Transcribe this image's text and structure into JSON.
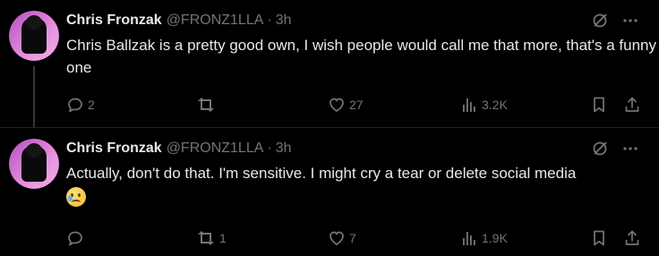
{
  "tweets": [
    {
      "name": "Chris Fronzak",
      "handle": "@FRONZ1LLA",
      "separator": "·",
      "time": "3h",
      "text": "Chris Ballzak is a pretty good own, I wish people would call me that more, that's a funny one",
      "replies": "2",
      "retweets": "",
      "likes": "27",
      "views": "3.2K"
    },
    {
      "name": "Chris Fronzak",
      "handle": "@FRONZ1LLA",
      "separator": "·",
      "time": "3h",
      "text": "Actually, don't do that. I'm sensitive. I might cry a tear or delete social media",
      "emoji": "crying-face",
      "replies": "",
      "retweets": "1",
      "likes": "7",
      "views": "1.9K"
    }
  ],
  "colors": {
    "background": "#000000",
    "text": "#e7e9ea",
    "muted": "#71767b",
    "avatar_accent": "#c35ec9"
  }
}
